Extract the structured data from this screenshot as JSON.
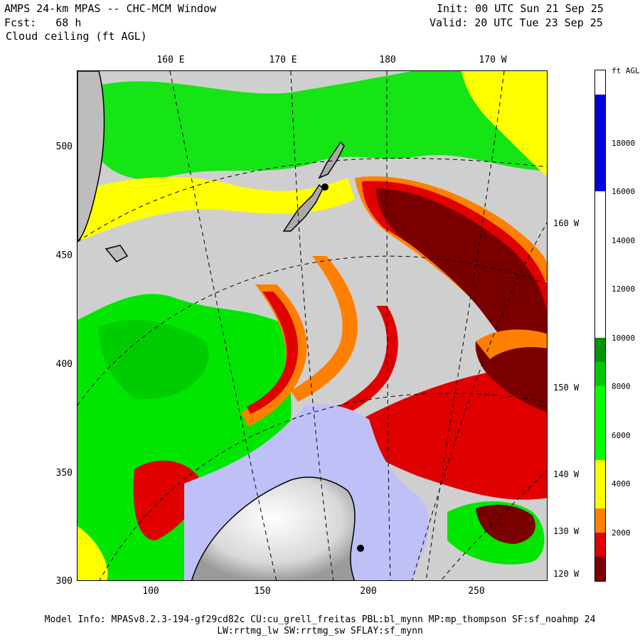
{
  "header": {
    "line1_left": "AMPS 24-km MPAS -- CHC-MCM Window",
    "line2_left": "Fcst:   68 h",
    "line3_left": "Cloud ceiling (ft AGL)",
    "line1_right": "Init: 00 UTC Sun 21 Sep 25",
    "line2_right": "Valid: 20 UTC Tue 23 Sep 25"
  },
  "top_lon_labels": [
    "160 E",
    "170 E",
    "180",
    "170 W"
  ],
  "right_lon_labels": [
    "160 W",
    "150 W",
    "140 W",
    "130 W",
    "120 W"
  ],
  "y_ticks": [
    "500",
    "450",
    "400",
    "350",
    "300"
  ],
  "x_ticks": [
    "100",
    "150",
    "200",
    "250"
  ],
  "colorbar": {
    "unit": "ft AGL",
    "labels": [
      "18000",
      "16000",
      "14000",
      "12000",
      "10000",
      "8000",
      "6000",
      "4000",
      "2000"
    ],
    "colors": {
      "dark_red": "#7a0000",
      "red": "#e00000",
      "orange": "#ff8000",
      "yellow": "#ffff00",
      "light_green": "#00ff00",
      "green": "#00c800",
      "dark_green": "#009600",
      "white": "#ffffff",
      "blue": "#0000e0",
      "lavender": "#c0c0f8",
      "land_gray": "#cfcfcf"
    }
  },
  "footer": {
    "line1": "Model Info: MPASv8.2.3-194-gf29cd82c CU:cu_grell_freitas PBL:bl_mynn MP:mp_thompson SF:sf_noahmp 24",
    "line2": "LW:rrtmg_lw SW:rrtmg_sw SFLAY:sf_mynn"
  }
}
